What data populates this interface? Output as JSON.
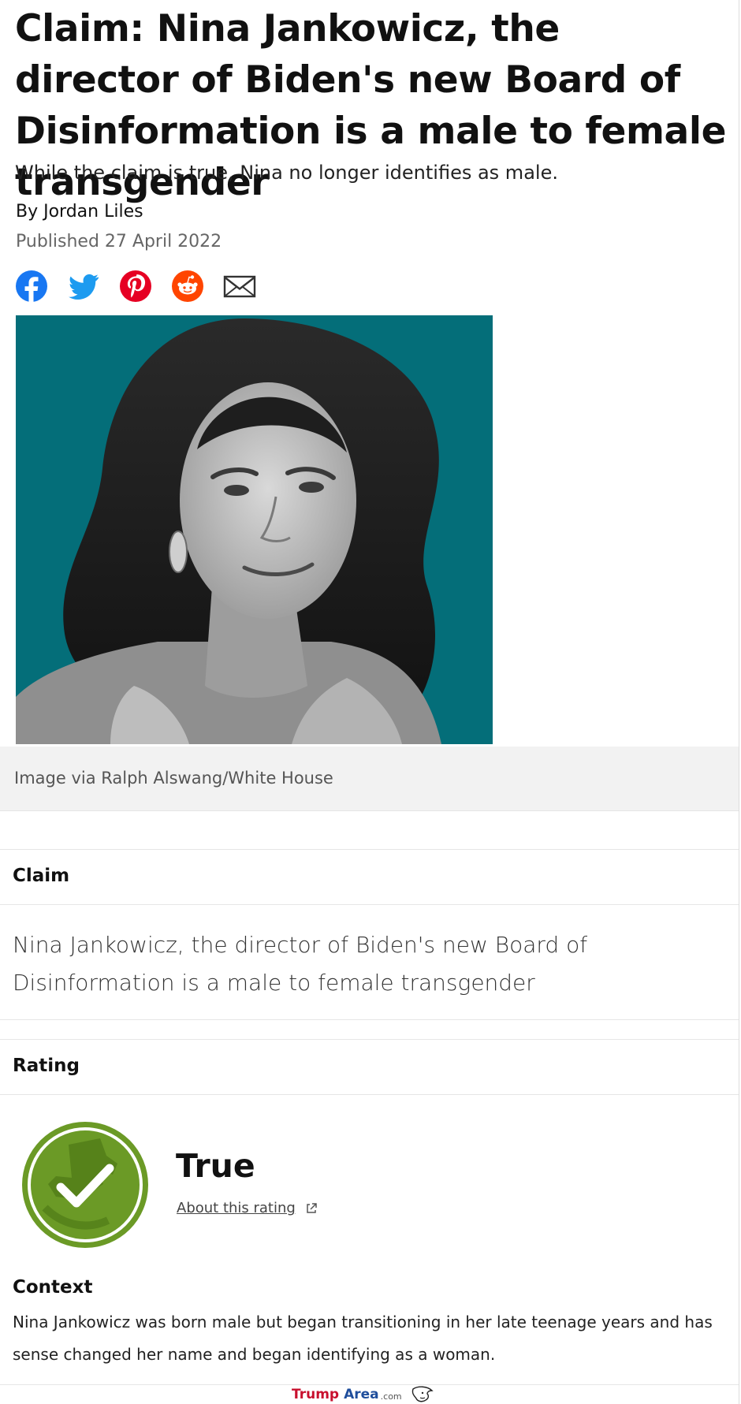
{
  "article": {
    "title": "Claim: Nina Jankowicz, the director of Biden's new Board of Disinformation is a male to female transgender",
    "subtitle": "While the claim is true, Nina no longer identifies as male.",
    "byline": "By Jordan Liles",
    "published": "Published 27 April 2022"
  },
  "share": {
    "icons": [
      "facebook-icon",
      "twitter-icon",
      "pinterest-icon",
      "reddit-icon",
      "email-icon"
    ],
    "colors": {
      "facebook": "#1877f2",
      "twitter": "#1d9bf0",
      "pinterest": "#e60023",
      "reddit": "#ff4500",
      "email": "#333333"
    }
  },
  "image": {
    "background_color": "#046e79",
    "caption": "Image via Ralph Alswang/White House"
  },
  "claim": {
    "label": "Claim",
    "text": "Nina Jankowicz, the director of Biden's new Board of Disinformation is a male to female transgender"
  },
  "rating": {
    "label": "Rating",
    "value": "True",
    "about_link": "About this rating",
    "badge_color": "#6b9a26"
  },
  "context": {
    "label": "Context",
    "text": "Nina Jankowicz was born male but began transitioning in her late teenage years and has sense changed her name and began identifying as a woman."
  },
  "watermark": {
    "part1": "Trump",
    "part2": "Area",
    "part3": ".com"
  }
}
